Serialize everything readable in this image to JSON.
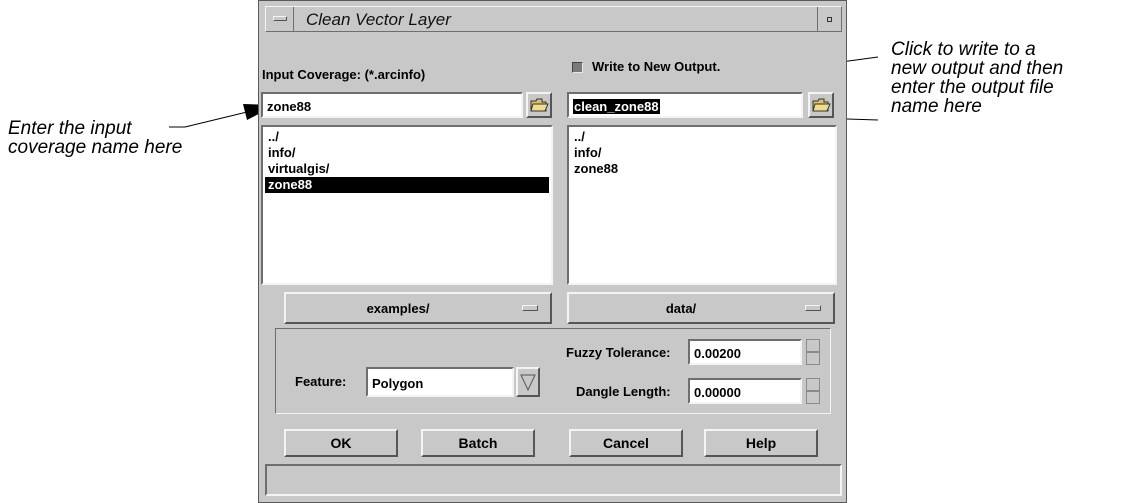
{
  "annotations": {
    "left": "Enter the input\ncoverage name here",
    "right_top": "Click to write to a\nnew output and then\nenter the output file\nname here"
  },
  "window": {
    "title": "Clean Vector Layer"
  },
  "input": {
    "label": "Input Coverage: (*.arcinfo)",
    "value": "zone88",
    "list": [
      "../",
      "info/",
      "virtualgis/",
      "zone88"
    ],
    "selected_item": "zone88",
    "directory": "examples/"
  },
  "output": {
    "checkbox_label": "Write to New Output.",
    "value": "clean_zone88",
    "list": [
      "../",
      "info/",
      "zone88"
    ],
    "directory": "data/"
  },
  "options": {
    "feature_label": "Feature:",
    "feature_value": "Polygon",
    "fuzzy_label": "Fuzzy Tolerance:",
    "fuzzy_value": "0.00200",
    "dangle_label": "Dangle Length:",
    "dangle_value": "0.00000"
  },
  "buttons": {
    "ok": "OK",
    "batch": "Batch",
    "cancel": "Cancel",
    "help": "Help"
  },
  "status": {
    "text": ""
  },
  "colors": {
    "window_bg": "#c8c8c8",
    "selection_bg": "#000000",
    "selection_fg": "#ffffff"
  },
  "icons": [
    "window-menu-icon",
    "minimize-icon",
    "folder-open-icon",
    "dropdown-arrow-icon",
    "spin-up-icon",
    "spin-down-icon"
  ]
}
